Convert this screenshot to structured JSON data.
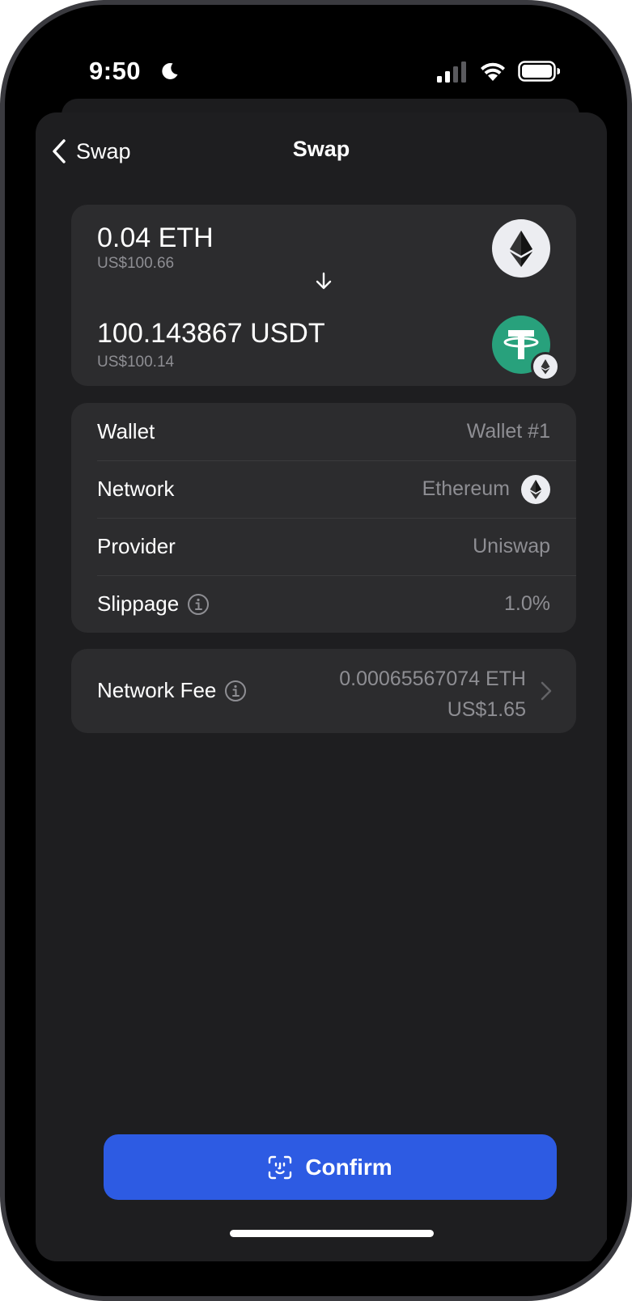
{
  "status_bar": {
    "time": "9:50",
    "icons": [
      "moon-icon",
      "signal-icon",
      "wifi-icon",
      "battery-icon"
    ]
  },
  "nav": {
    "back_label": "Swap",
    "title": "Swap"
  },
  "swap": {
    "from": {
      "amount": "0.04 ETH",
      "fiat": "US$100.66",
      "token_icon": "ethereum-icon"
    },
    "to": {
      "amount": "100.143867 USDT",
      "fiat": "US$100.14",
      "token_icon": "tether-icon",
      "network_badge_icon": "ethereum-icon"
    },
    "arrow_icon": "arrow-down-icon"
  },
  "details": {
    "wallet": {
      "label": "Wallet",
      "value": "Wallet #1"
    },
    "network": {
      "label": "Network",
      "value": "Ethereum"
    },
    "provider": {
      "label": "Provider",
      "value": "Uniswap"
    },
    "slippage": {
      "label": "Slippage",
      "value": "1.0%"
    }
  },
  "fee": {
    "label": "Network Fee",
    "crypto": "0.00065567074 ETH",
    "fiat": "US$1.65"
  },
  "confirm": {
    "label": "Confirm",
    "icon": "face-id-icon"
  },
  "colors": {
    "background": "#000000",
    "sheet": "#1e1e20",
    "card": "#2c2c2e",
    "secondary_text": "#8e8e93",
    "accent": "#2d5be3",
    "tether": "#28a17c"
  }
}
